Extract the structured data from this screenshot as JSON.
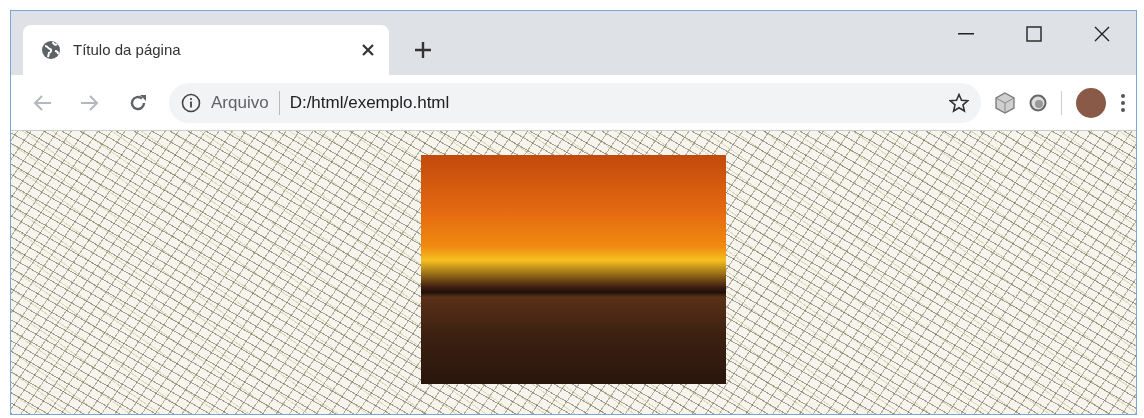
{
  "window": {
    "title": "Título da página"
  },
  "toolbar": {
    "back": {
      "disabled": true
    },
    "forward": {
      "disabled": true
    },
    "address": {
      "scheme_label": "Arquivo",
      "url": "D:/html/exemplo.html"
    }
  }
}
